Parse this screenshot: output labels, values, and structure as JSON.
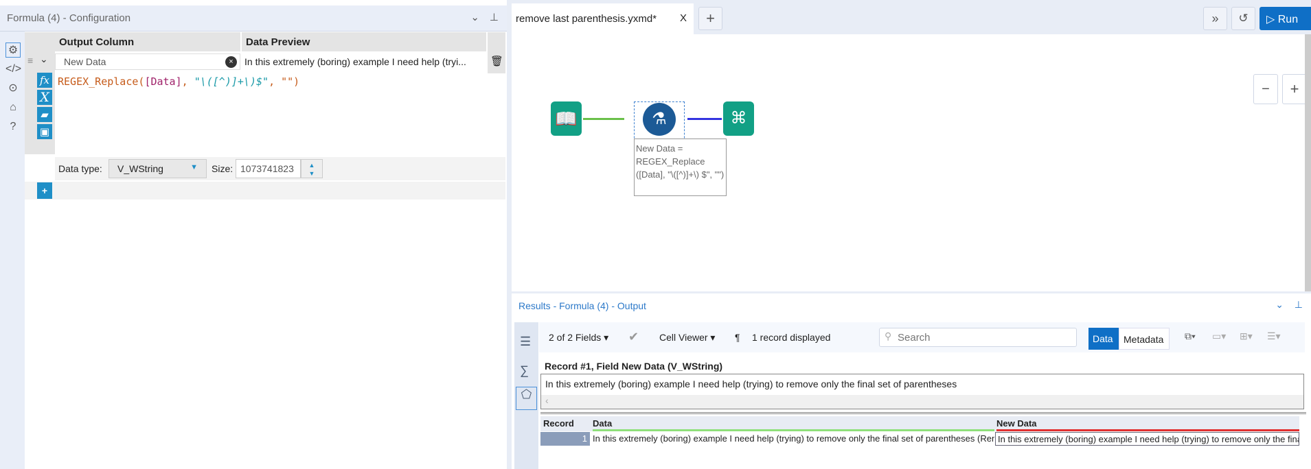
{
  "config": {
    "title": "Formula (4) - Configuration",
    "col_output": "Output Column",
    "col_preview": "Data Preview",
    "output_value": "New Data",
    "preview_value": "In this extremely (boring) example I need help (tryi...",
    "expr": {
      "fn": "REGEX_Replace(",
      "field": "[Data]",
      "sep": ", ",
      "pattern": "\"\\([^)]+\\)$\"",
      "rest": ", \"\")"
    },
    "data_type_label": "Data type:",
    "data_type": "V_WString",
    "size_label": "Size:",
    "size": "1073741823"
  },
  "tab": {
    "name": "remove  last parenthesis.yxmd*",
    "close": "X",
    "add": "+"
  },
  "toolbar": {
    "expand": "»",
    "run": "Run"
  },
  "zoom": {
    "out": "−",
    "in": "+"
  },
  "annotation": "New Data = REGEX_Replace ([Data], \"\\([^)]+\\) $\", \"\")",
  "results": {
    "title": "Results - Formula (4) - Output",
    "fields": "2 of 2 Fields",
    "viewer": "Cell Viewer",
    "pilcrow": "¶",
    "records": "1 record displayed",
    "search_placeholder": "Search",
    "data_tab": "Data",
    "metadata_tab": "Metadata",
    "cell_header": "Record #1, Field New Data (V_WString)",
    "cell_value": "In this extremely (boring) example I need help (trying) to remove only the final set of parentheses",
    "columns": [
      "Record",
      "Data",
      "New Data"
    ],
    "rows": [
      {
        "record": "1",
        "data": "In this extremely (boring) example I need help (trying) to remove only the final set of parentheses (Remove me)",
        "new_data": "In this extremely (boring) example I need help (trying) to remove only the final set of parentheses"
      }
    ]
  },
  "colors": {
    "accent": "#0f6fc6",
    "tool_teal": "#12a085",
    "formula_blue": "#1c5a96"
  }
}
